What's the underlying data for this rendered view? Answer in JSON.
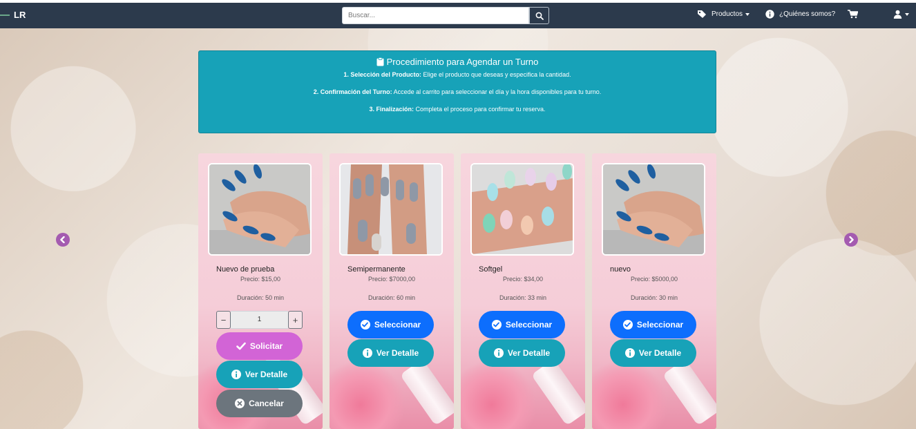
{
  "navbar": {
    "brand": "LR",
    "search_placeholder": "Buscar...",
    "products_label": "Productos",
    "about_label": "¿Quiénes somos?"
  },
  "info": {
    "title": "Procedimiento para Agendar un Turno",
    "steps": [
      {
        "bold": "1. Selección del Producto:",
        "text": " Elige el producto que deseas y especifica la cantidad."
      },
      {
        "bold": "2. Confirmación del Turno:",
        "text": " Accede al carrito para seleccionar el día y la hora disponibles para tu turno."
      },
      {
        "bold": "3. Finalización:",
        "text": " Completa el proceso para confirmar tu reserva."
      }
    ]
  },
  "products": [
    {
      "name": "Nuevo de prueba",
      "price": "Precio: $15,00",
      "duration": "Duración: 50 min",
      "quantity": "1"
    },
    {
      "name": "Semipermanente",
      "price": "Precio: $7000,00",
      "duration": "Duración: 60 min"
    },
    {
      "name": "Softgel",
      "price": "Precio: $34,00",
      "duration": "Duración: 33 min"
    },
    {
      "name": "nuevo",
      "price": "Precio: $5000,00",
      "duration": "Duración: 30 min"
    }
  ],
  "buttons": {
    "select": "Seleccionar",
    "detail": "Ver Detalle",
    "request": "Solicitar",
    "cancel": "Cancelar",
    "minus": "−",
    "plus": "+"
  },
  "colors": {
    "navbar": "#2c3a4c",
    "info": "#17a2b8",
    "primary": "#0d6efd",
    "purple": "#d264d6",
    "gray": "#6c757d",
    "arrow": "#a45bb0"
  }
}
